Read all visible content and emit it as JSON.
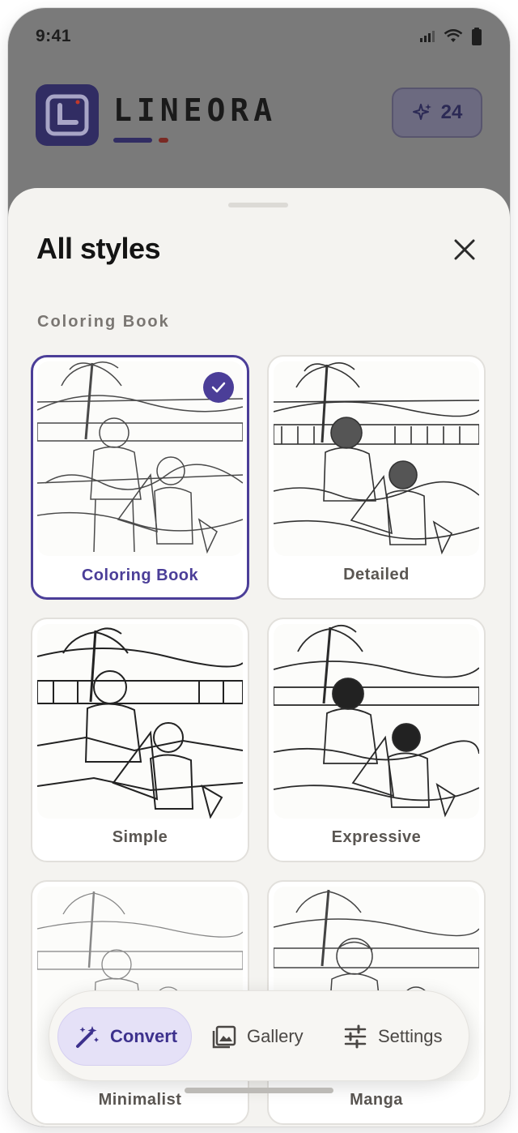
{
  "status_bar": {
    "time": "9:41"
  },
  "header": {
    "brand": "LINEORA",
    "credits": "24",
    "colors": {
      "logo_bg": "#312d63",
      "accent": "#4b3e98",
      "underline_red": "#c0392b"
    }
  },
  "sheet": {
    "title": "All styles",
    "section": "Coloring Book",
    "styles": [
      {
        "label": "Coloring Book",
        "selected": true
      },
      {
        "label": "Detailed",
        "selected": false
      },
      {
        "label": "Simple",
        "selected": false
      },
      {
        "label": "Expressive",
        "selected": false
      },
      {
        "label": "Minimalist",
        "selected": false
      },
      {
        "label": "Manga",
        "selected": false
      }
    ]
  },
  "nav": {
    "convert": "Convert",
    "gallery": "Gallery",
    "settings": "Settings",
    "active": "Convert"
  },
  "icons": [
    "signal-icon",
    "wifi-icon",
    "battery-icon",
    "sparkle-icon",
    "close-icon",
    "check-icon",
    "magic-wand-icon",
    "image-icon",
    "sliders-icon"
  ]
}
